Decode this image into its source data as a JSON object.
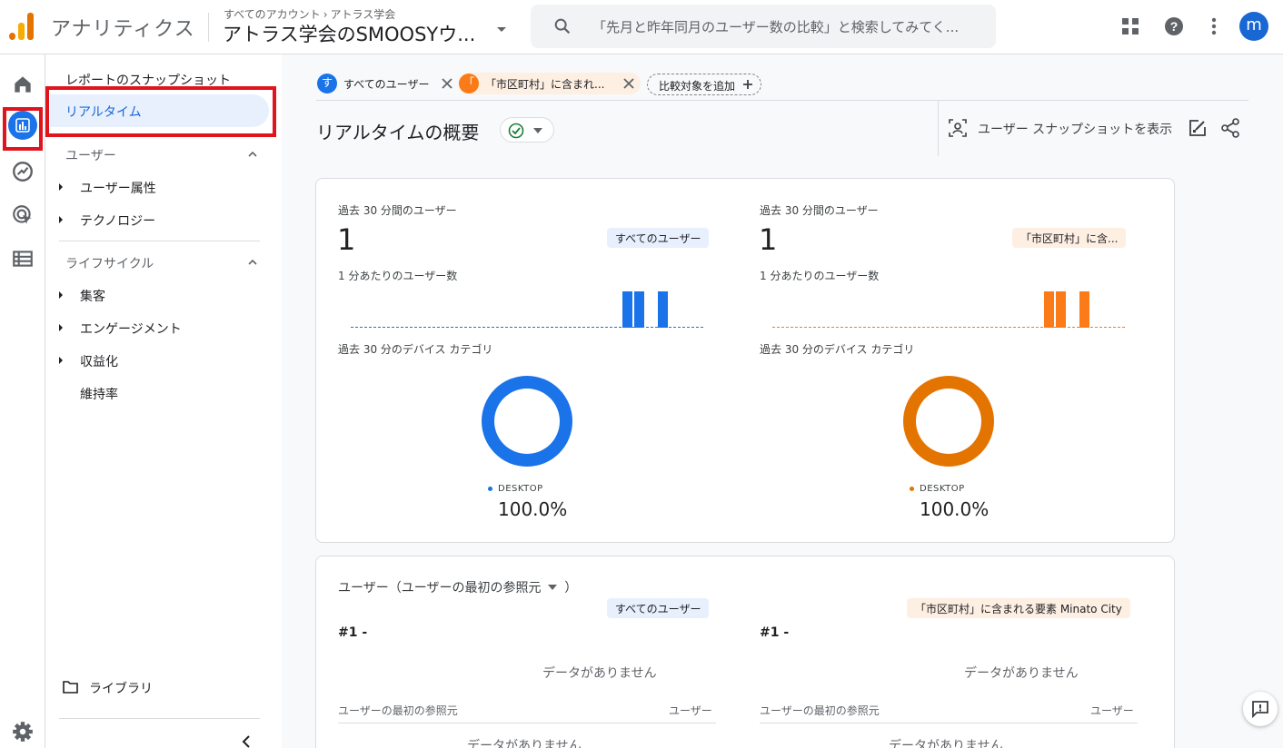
{
  "app": {
    "title": "アナリティクス"
  },
  "breadcrumb": {
    "account": "すべてのアカウント",
    "separator": "›",
    "property_path": "アトラス学会"
  },
  "property": {
    "name": "アトラス学会のSMOOSYウ..."
  },
  "search": {
    "placeholder": "「先月と昨年同月のユーザー数の比較」と検索してみてく..."
  },
  "topbar": {
    "avatar_letter": "m"
  },
  "nav": {
    "snapshot": "レポートのスナップショット",
    "realtime": "リアルタイム",
    "user_section": "ユーザー",
    "user_items": [
      "ユーザー属性",
      "テクノロジー"
    ],
    "lifecycle_section": "ライフサイクル",
    "lifecycle_items": [
      "集客",
      "エンゲージメント",
      "収益化",
      "維持率"
    ],
    "library": "ライブラリ"
  },
  "comparisons": {
    "chip1": {
      "badge": "す",
      "label": "すべてのユーザー",
      "color": "#1a73e8"
    },
    "chip2": {
      "badge": "「",
      "label": "「市区町村」に含まれ...",
      "color": "#fa7b17"
    },
    "add": "比較対象を追加"
  },
  "page": {
    "title": "リアルタイムの概要",
    "snapshot_link": "ユーザー スナップショットを表示"
  },
  "card1": {
    "left": {
      "users_label": "過去 30 分間のユーザー",
      "users_value": "1",
      "segment": "すべてのユーザー",
      "per_minute_label": "1 分あたりのユーザー数",
      "device_label": "過去 30 分のデバイス カテゴリ",
      "legend": "DESKTOP",
      "percent": "100.0%",
      "color": "#1a73e8"
    },
    "right": {
      "users_label": "過去 30 分間のユーザー",
      "users_value": "1",
      "segment": "「市区町村」に含...",
      "per_minute_label": "1 分あたりのユーザー数",
      "device_label": "過去 30 分のデバイス カテゴリ",
      "legend": "DESKTOP",
      "percent": "100.0%",
      "color": "#e37400"
    }
  },
  "card2": {
    "title": "ユーザー（ユーザーの最初の参照元",
    "title_end": "）",
    "left": {
      "segment": "すべてのユーザー",
      "rank": "#1  -",
      "no_data": "データがありません",
      "col1": "ユーザーの最初の参照元",
      "col2": "ユーザー"
    },
    "right": {
      "segment": "「市区町村」に含まれる要素 Minato City",
      "rank": "#1  -",
      "no_data": "データがありません",
      "col1": "ユーザーの最初の参照元",
      "col2": "ユーザー"
    }
  },
  "chart_data": [
    {
      "type": "bar",
      "title": "1 分あたりのユーザー数",
      "series": [
        {
          "name": "すべてのユーザー",
          "values": [
            0,
            0,
            0,
            0,
            0,
            0,
            0,
            0,
            0,
            0,
            0,
            0,
            0,
            0,
            0,
            0,
            0,
            0,
            0,
            0,
            0,
            0,
            0,
            0,
            0,
            1,
            1,
            0,
            1,
            0
          ]
        }
      ],
      "color": "#1a73e8"
    },
    {
      "type": "pie",
      "title": "過去 30 分のデバイス カテゴリ",
      "categories": [
        "DESKTOP"
      ],
      "values": [
        100.0
      ],
      "color": "#1a73e8"
    },
    {
      "type": "bar",
      "title": "1 分あたりのユーザー数",
      "series": [
        {
          "name": "「市区町村」に含...",
          "values": [
            0,
            0,
            0,
            0,
            0,
            0,
            0,
            0,
            0,
            0,
            0,
            0,
            0,
            0,
            0,
            0,
            0,
            0,
            0,
            0,
            0,
            0,
            0,
            0,
            0,
            1,
            1,
            0,
            1,
            0
          ]
        }
      ],
      "color": "#fa7b17"
    },
    {
      "type": "pie",
      "title": "過去 30 分のデバイス カテゴリ",
      "categories": [
        "DESKTOP"
      ],
      "values": [
        100.0
      ],
      "color": "#e37400"
    }
  ]
}
